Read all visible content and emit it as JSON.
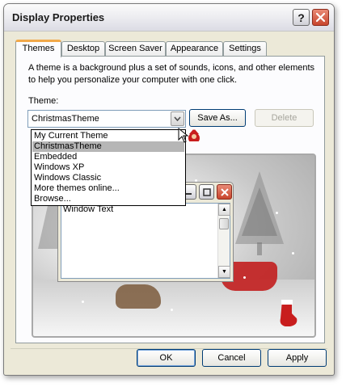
{
  "window": {
    "title": "Display Properties",
    "help_label": "?"
  },
  "tabs": [
    {
      "label": "Themes",
      "active": true
    },
    {
      "label": "Desktop"
    },
    {
      "label": "Screen Saver"
    },
    {
      "label": "Appearance"
    },
    {
      "label": "Settings"
    }
  ],
  "themes": {
    "description": "A theme is a background plus a set of sounds, icons, and other elements to help you personalize your computer with one click.",
    "theme_label": "Theme:",
    "selected": "ChristmasTheme",
    "save_as_label": "Save As...",
    "delete_label": "Delete",
    "options": [
      "My Current Theme",
      "ChristmasTheme",
      "Embedded",
      "Windows XP",
      "Windows Classic",
      "More themes online...",
      "Browse..."
    ]
  },
  "preview": {
    "window_text": "Window Text"
  },
  "footer": {
    "ok_label": "OK",
    "cancel_label": "Cancel",
    "apply_label": "Apply"
  },
  "colors": {
    "dialog_bg": "#ECE9D8",
    "close_button": "#c8452d",
    "selection": "#b6b6b6",
    "tab_highlight": "#f2a94a"
  }
}
